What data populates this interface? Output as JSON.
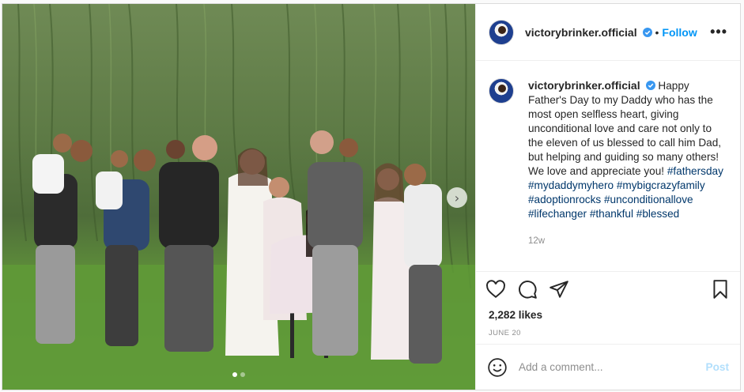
{
  "post": {
    "username": "victorybrinker.official",
    "separator": "•",
    "follow_label": "Follow",
    "more_label": "•••",
    "caption_text": "Happy Father's Day to my Daddy who has the most open selfless heart, giving unconditional love and care not only to the eleven of us blessed to call him Dad, but helping and guiding so many others! We love and appreciate you!",
    "hashtags": "#fathersday #mydaddymyhero #mybigcrazyfamily #adoptionrocks #unconditionallove #lifechanger #thankful #blessed",
    "time_ago": "12w",
    "likes": "2,282 likes",
    "date": "JUNE 20",
    "comment_placeholder": "Add a comment...",
    "post_label": "Post",
    "next_arrow": "›"
  },
  "icons": {
    "verified": "verified-badge-icon",
    "like": "heart-icon",
    "comment": "comment-bubble-icon",
    "share": "paper-plane-icon",
    "save": "bookmark-icon",
    "emoji": "smiley-icon"
  },
  "colors": {
    "accent": "#0095f6",
    "hashtag": "#00376b",
    "muted": "#8e8e8e",
    "post_disabled": "#b2dffc"
  },
  "carousel": {
    "slides": 2,
    "active": 1
  }
}
